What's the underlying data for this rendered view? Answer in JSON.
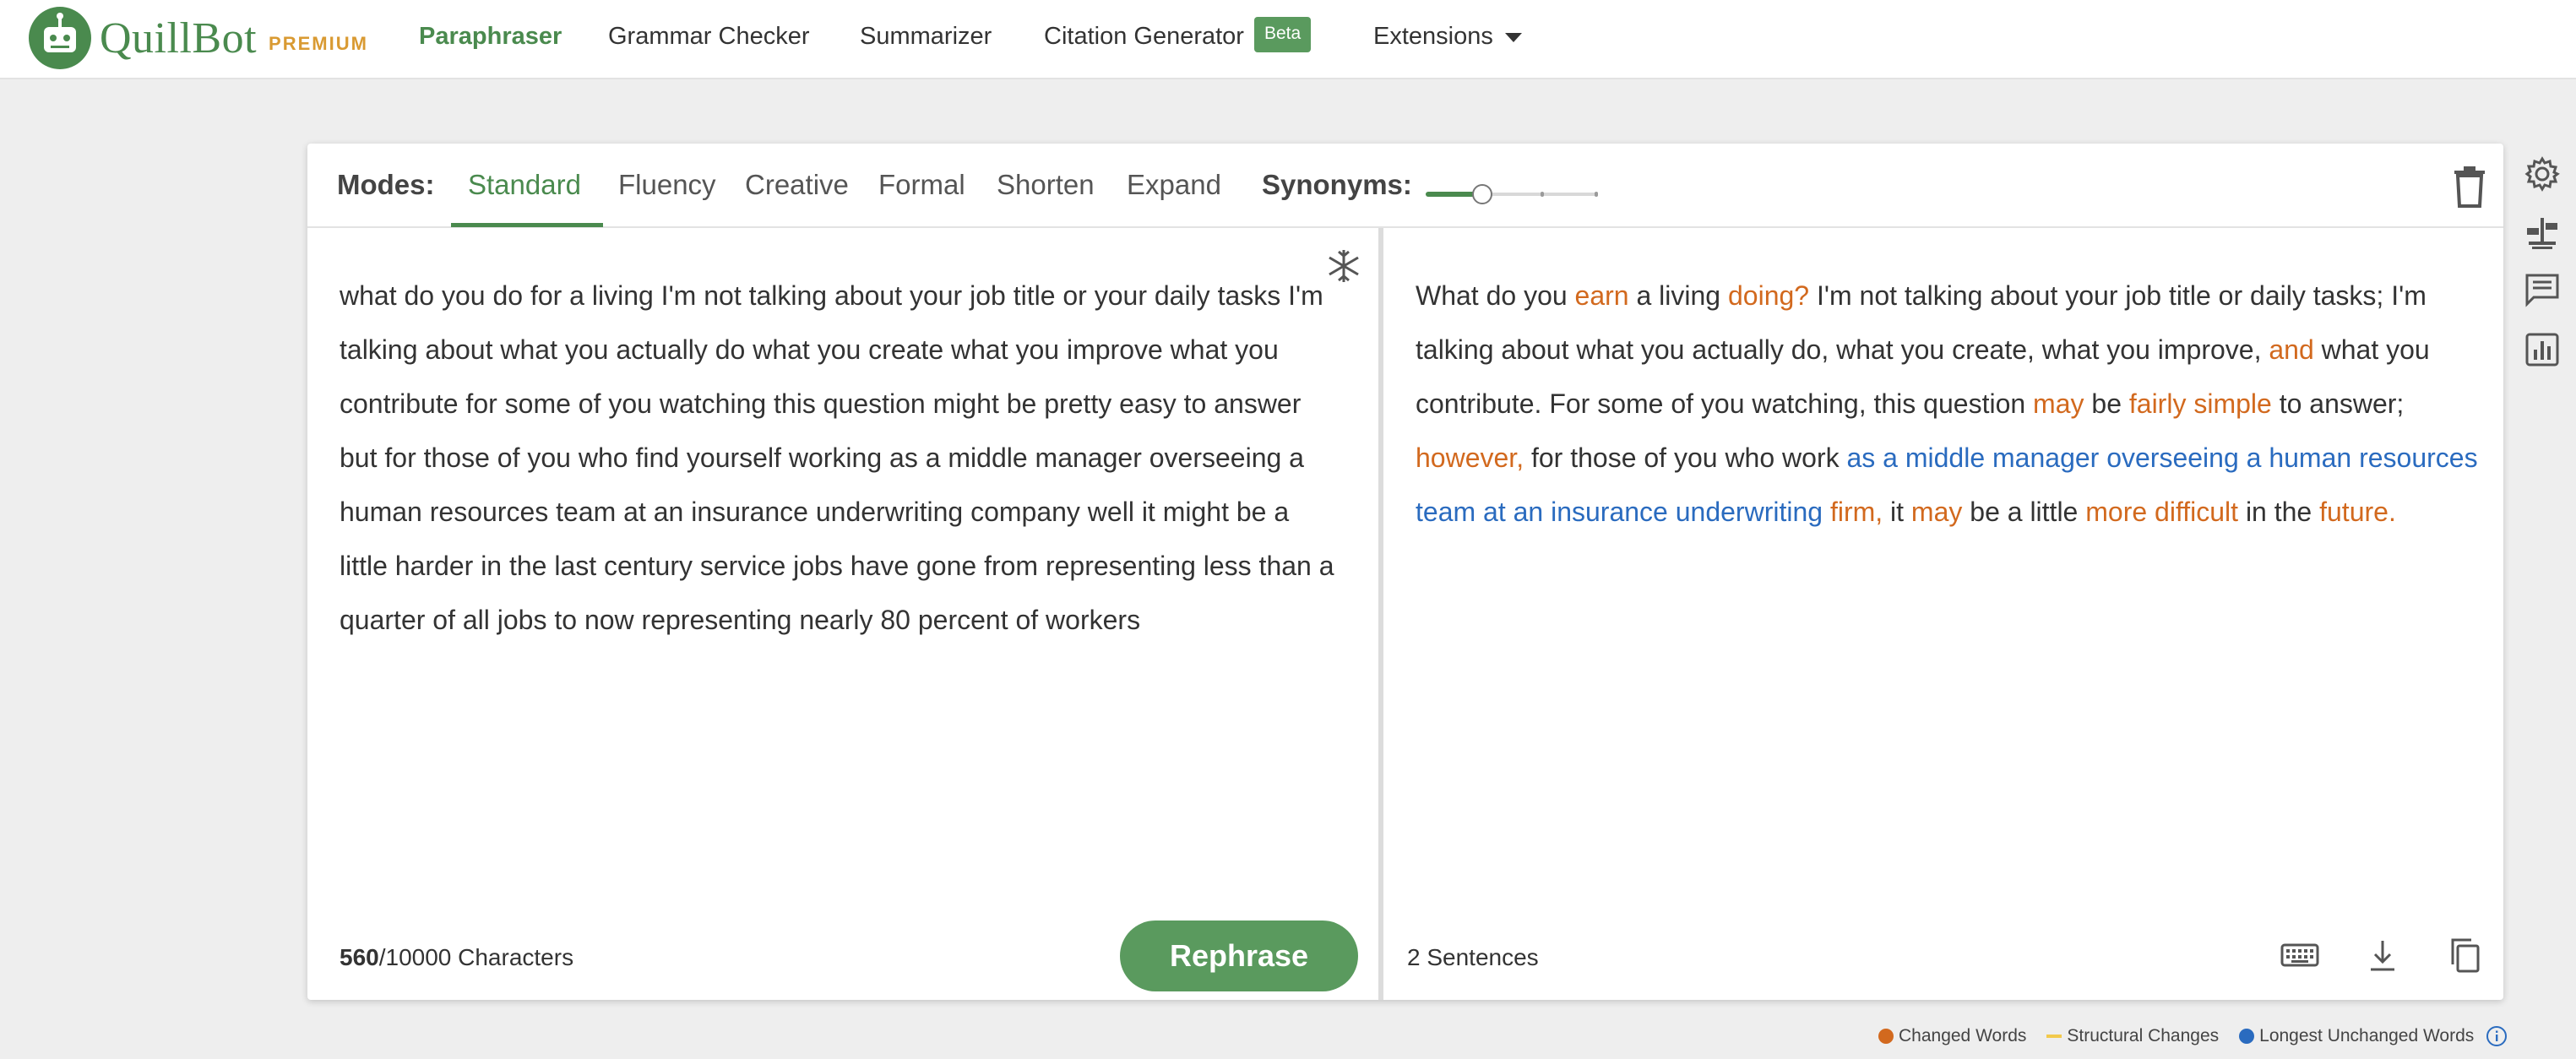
{
  "app": {
    "logo_name": "QuillBot",
    "logo_badge": "PREMIUM",
    "brand_color": "#4a8a4e",
    "accent_orange": "#d2691e",
    "accent_blue": "#2a6bbf"
  },
  "nav": {
    "paraphraser": "Paraphraser",
    "grammar_checker": "Grammar Checker",
    "summarizer": "Summarizer",
    "citation_generator": "Citation Generator",
    "citation_badge": "Beta",
    "extensions": "Extensions"
  },
  "modes": {
    "label": "Modes:",
    "items": [
      "Standard",
      "Fluency",
      "Creative",
      "Formal",
      "Shorten",
      "Expand"
    ],
    "active": "Standard"
  },
  "synonyms": {
    "label": "Synonyms:",
    "level_fraction": 0.33,
    "steps": 4
  },
  "input": {
    "text": "what do you do for a living I'm not talking about your job title or your daily tasks I'm talking about what you actually do what you create what you improve what you contribute for some of you watching this question might be pretty easy to answer but for those of you who find yourself working as a middle manager overseeing a human resources team at an insurance underwriting company well it might be a little harder in the last century service jobs have gone from representing less than a quarter of all jobs to now representing nearly 80 percent of workers",
    "char_count": "560",
    "char_limit": "/10000 Characters",
    "rephrase_label": "Rephrase"
  },
  "output": {
    "segments": [
      {
        "t": "What do you ",
        "k": "n"
      },
      {
        "t": "earn",
        "k": "c"
      },
      {
        "t": " a living ",
        "k": "n"
      },
      {
        "t": "doing?",
        "k": "c"
      },
      {
        "t": " I'm not talking about your job title or daily tasks; I'm talking about what you actually do, what you create, what you improve, ",
        "k": "n"
      },
      {
        "t": "and",
        "k": "c"
      },
      {
        "t": " what you contribute. For some of you watching, this question ",
        "k": "n"
      },
      {
        "t": "may",
        "k": "c"
      },
      {
        "t": " be ",
        "k": "n"
      },
      {
        "t": "fairly simple",
        "k": "c"
      },
      {
        "t": " to answer; ",
        "k": "n"
      },
      {
        "t": "however,",
        "k": "c"
      },
      {
        "t": " for those of you who work ",
        "k": "n"
      },
      {
        "t": "as a middle manager overseeing a human resources team at an insurance underwriting",
        "k": "u"
      },
      {
        "t": " ",
        "k": "n"
      },
      {
        "t": "firm,",
        "k": "c"
      },
      {
        "t": " it ",
        "k": "n"
      },
      {
        "t": "may",
        "k": "c"
      },
      {
        "t": " be a little ",
        "k": "n"
      },
      {
        "t": "more difficult",
        "k": "c"
      },
      {
        "t": " in the ",
        "k": "n"
      },
      {
        "t": "future.",
        "k": "c"
      }
    ],
    "sentence_count": "2 Sentences"
  },
  "legend": {
    "changed": "Changed Words",
    "structural": "Structural Changes",
    "unchanged": "Longest Unchanged Words",
    "changed_color": "#d2691e",
    "structural_color": "#f2c94c",
    "unchanged_color": "#2a6bbf"
  },
  "icons": {
    "freeze": "freeze-snowflake-icon",
    "trash": "trash-icon",
    "settings": "gear-icon",
    "compare": "compare-modes-icon",
    "feedback": "feedback-icon",
    "statistics": "statistics-icon",
    "keyboard": "keyboard-icon",
    "download": "download-icon",
    "copy": "copy-icon",
    "info": "info-icon"
  }
}
